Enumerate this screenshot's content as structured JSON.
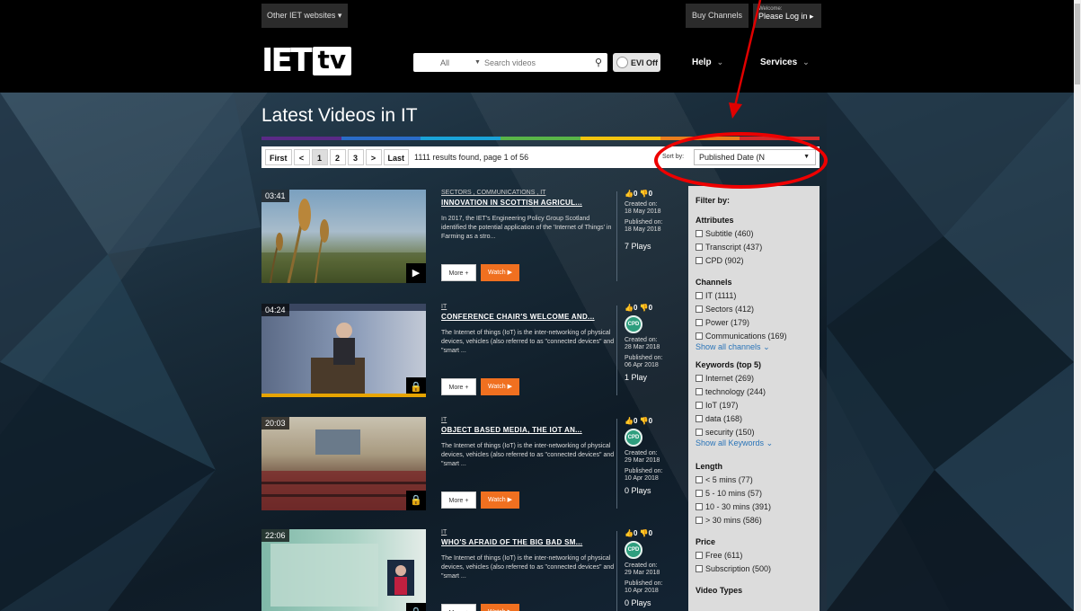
{
  "topbar": {
    "other_sites": "Other IET websites",
    "buy_channels": "Buy Channels",
    "welcome": "Welcome:",
    "login": "Please Log in ▸"
  },
  "header": {
    "logo_iet": "IET",
    "logo_tv": "tv",
    "search_scope": "All",
    "search_placeholder": "Search videos",
    "evi": "EVI Off",
    "help": "Help",
    "services": "Services"
  },
  "page": {
    "title": "Latest Videos in IT"
  },
  "pager": {
    "first": "First",
    "prev": "<",
    "pages": [
      "1",
      "2",
      "3"
    ],
    "current_page": "1",
    "next": ">",
    "last": "Last",
    "results": "1111 results found, page 1 of 56",
    "sort_label": "Sort by:",
    "sort_value": "Published Date (N"
  },
  "colors": {
    "rainbow": [
      "#5a2a86",
      "#2a6cc8",
      "#1aa3d8",
      "#59b548",
      "#f2c40f",
      "#e97d1d",
      "#d62b2b"
    ],
    "accent_orange": "#f07020",
    "annotation_red": "#e00000"
  },
  "videos": [
    {
      "duration": "03:41",
      "tags": "SECTORS , COMMUNICATIONS , IT",
      "title": "INNOVATION IN SCOTTISH AGRICUL...",
      "desc": "In 2017, the IET's Engineering Policy Group Scotland identified the potential application of the 'Internet of Things' in Farming as a stro...",
      "likes": "0",
      "dislikes": "0",
      "cpd": false,
      "created_label": "Created on:",
      "created": "18 May 2018",
      "published_label": "Published on:",
      "published": "18 May 2018",
      "plays": "7 Plays",
      "corner_icon": "play-icon",
      "more": "More +",
      "watch": "Watch ▶"
    },
    {
      "duration": "04:24",
      "tags": "IT",
      "title": "CONFERENCE CHAIR'S WELCOME AND...",
      "desc": "The Internet of things (IoT) is the inter-networking of physical devices, vehicles (also referred to as \"connected devices\" and \"smart ...",
      "likes": "0",
      "dislikes": "0",
      "cpd": true,
      "created_label": "Created on:",
      "created": "28 Mar 2018",
      "published_label": "Published on:",
      "published": "06 Apr 2018",
      "plays": "1 Play",
      "corner_icon": "lock-icon",
      "more": "More +",
      "watch": "Watch ▶"
    },
    {
      "duration": "20:03",
      "tags": "IT",
      "title": "OBJECT BASED MEDIA, THE IOT AN...",
      "desc": "The Internet of things (IoT) is the inter-networking of physical devices, vehicles (also referred to as \"connected devices\" and \"smart ...",
      "likes": "0",
      "dislikes": "0",
      "cpd": true,
      "created_label": "Created on:",
      "created": "29 Mar 2018",
      "published_label": "Published on:",
      "published": "10 Apr 2018",
      "plays": "0 Plays",
      "corner_icon": "lock-icon",
      "more": "More +",
      "watch": "Watch ▶"
    },
    {
      "duration": "22:06",
      "tags": "IT",
      "title": "WHO'S AFRAID OF THE BIG BAD SM...",
      "desc": "The Internet of things (IoT) is the inter-networking of physical devices, vehicles (also referred to as \"connected devices\" and \"smart ...",
      "likes": "0",
      "dislikes": "0",
      "cpd": true,
      "created_label": "Created on:",
      "created": "29 Mar 2018",
      "published_label": "Published on:",
      "published": "10 Apr 2018",
      "plays": "0 Plays",
      "corner_icon": "lock-icon",
      "more": "More +",
      "watch": "Watch ▶"
    }
  ],
  "filter": {
    "heading": "Filter by:",
    "cpd_badge": "CPD",
    "attributes": {
      "title": "Attributes",
      "items": [
        "Subtitle (460)",
        "Transcript (437)",
        "CPD (902)"
      ]
    },
    "channels": {
      "title": "Channels",
      "items": [
        "IT (1111)",
        "Sectors (412)",
        "Power (179)",
        "Communications (169)"
      ],
      "show_all": "Show all channels"
    },
    "keywords": {
      "title": "Keywords (top 5)",
      "items": [
        "Internet (269)",
        "technology (244)",
        "IoT (197)",
        "data (168)",
        "security (150)"
      ],
      "show_all": "Show all Keywords"
    },
    "length": {
      "title": "Length",
      "items": [
        "< 5 mins (77)",
        "5 - 10 mins (57)",
        "10 - 30 mins (391)",
        "> 30 mins (586)"
      ]
    },
    "price": {
      "title": "Price",
      "items": [
        "Free (611)",
        "Subscription (500)"
      ]
    },
    "video_types": {
      "title": "Video Types"
    }
  }
}
